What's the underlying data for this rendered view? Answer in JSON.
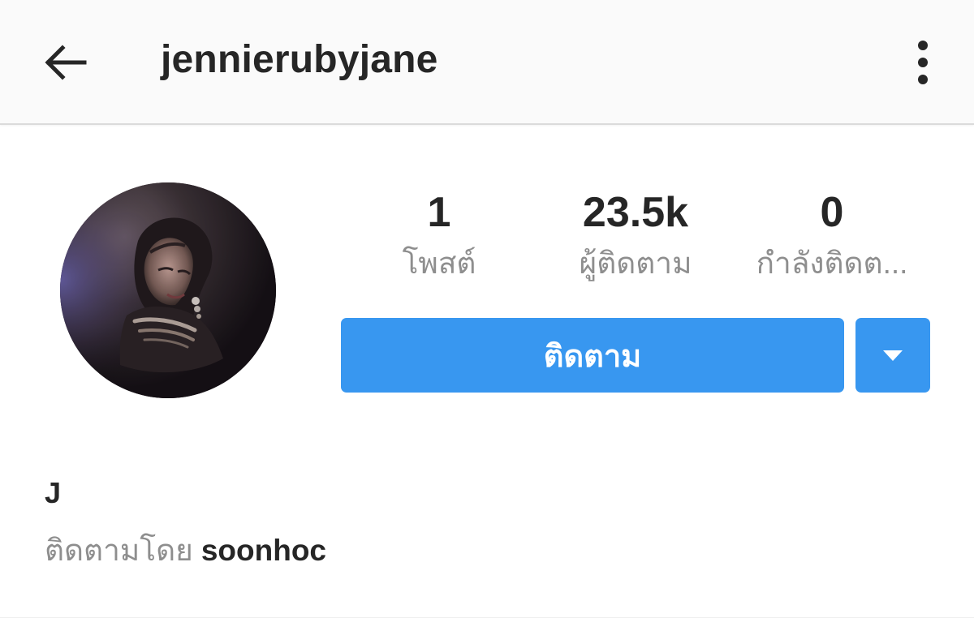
{
  "header": {
    "username": "jennierubyjane",
    "back_icon": "arrow-left-icon",
    "more_icon": "three-dots-vertical-icon"
  },
  "profile": {
    "avatar_icon": "profile-avatar",
    "stats": [
      {
        "value": "1",
        "label": "โพสต์"
      },
      {
        "value": "23.5k",
        "label": "ผู้ติดตาม"
      },
      {
        "value": "0",
        "label": "กำลังติดต..."
      }
    ],
    "follow_button_label": "ติดตาม",
    "dropdown_icon": "caret-down-icon",
    "display_name": "J",
    "followed_by_prefix": "ติดตามโดย",
    "followed_by_name": "soonhoc"
  },
  "colors": {
    "accent_blue": "#3897f0",
    "text_primary": "#262626",
    "text_secondary": "#8e8e8e",
    "header_bg": "#fafafa"
  }
}
